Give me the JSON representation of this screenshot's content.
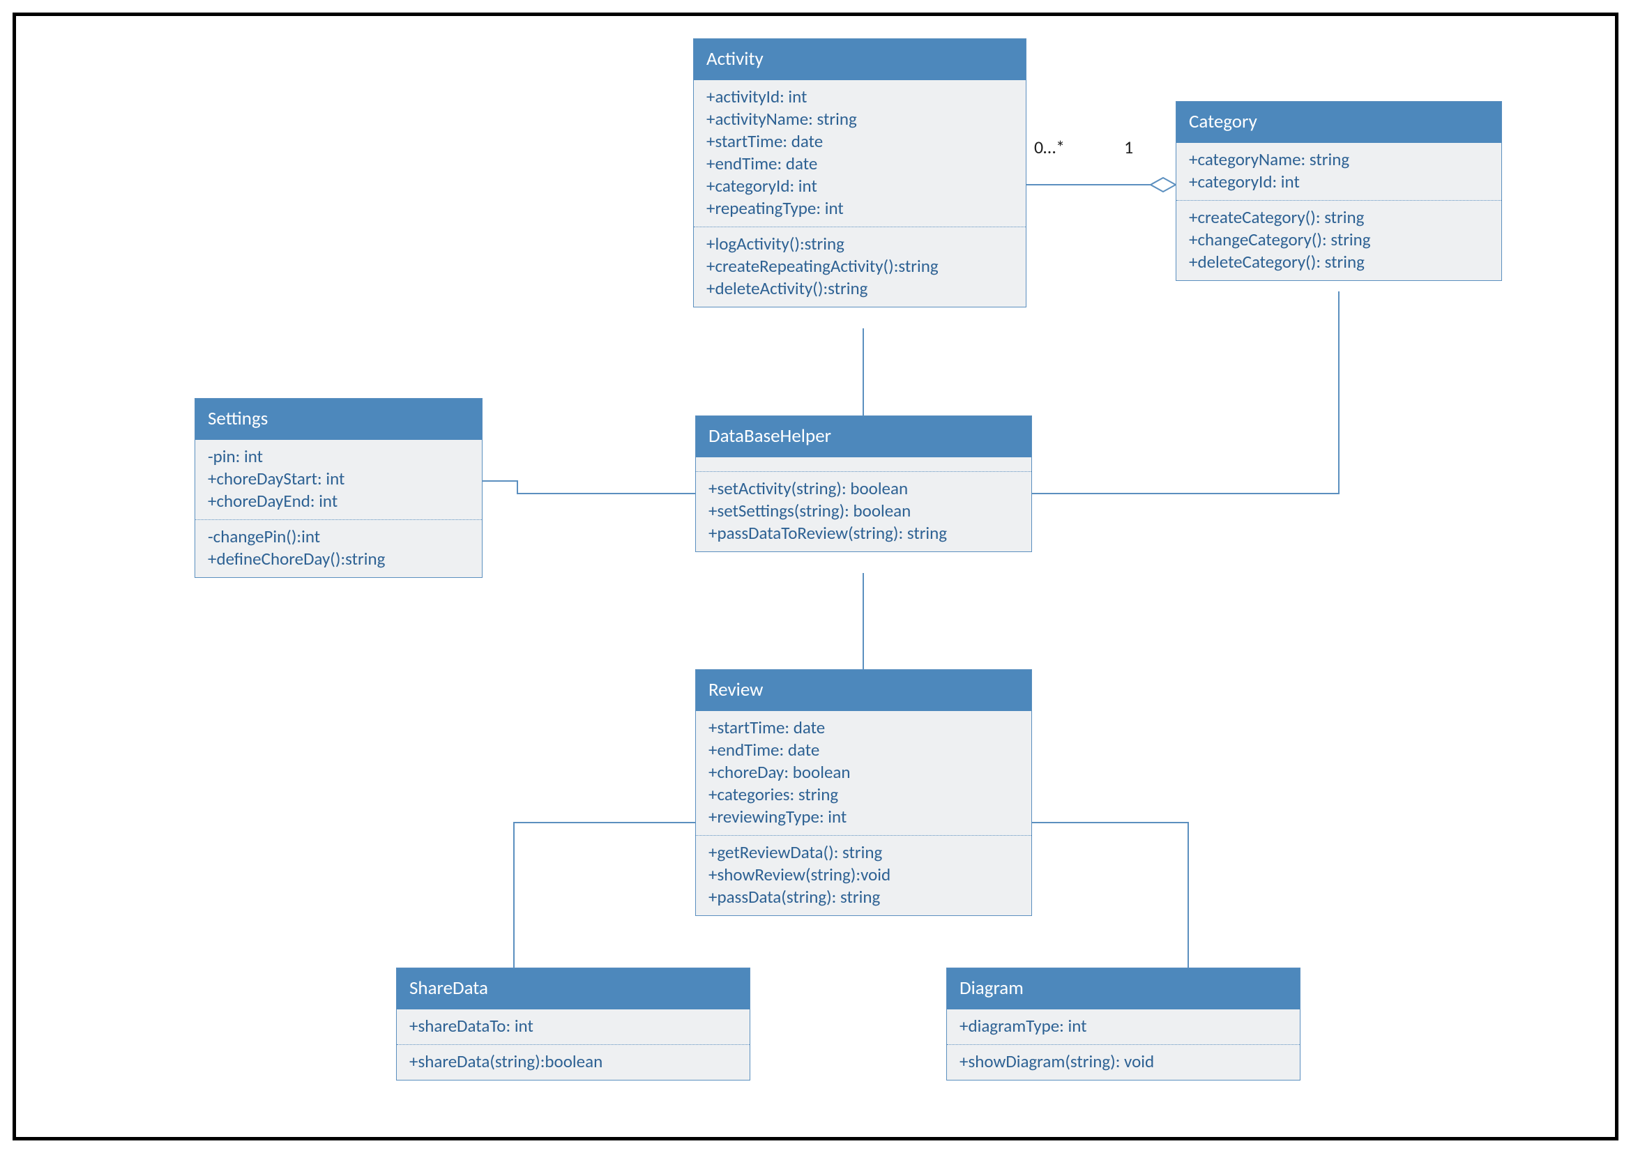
{
  "classes": {
    "activity": {
      "name": "Activity",
      "attrs": [
        "+activityId: int",
        "+activityName: string",
        "+startTime: date",
        "+endTime: date",
        "+categoryId: int",
        "+repeatingType: int"
      ],
      "ops": [
        "+logActivity():string",
        "+createRepeatingActivity():string",
        "+deleteActivity():string"
      ]
    },
    "category": {
      "name": "Category",
      "attrs": [
        "+categoryName: string",
        "+categoryId: int"
      ],
      "ops": [
        "+createCategory(): string",
        "+changeCategory(): string",
        "+deleteCategory(): string"
      ]
    },
    "settings": {
      "name": "Settings",
      "attrs": [
        "-pin: int",
        "+choreDayStart: int",
        "+choreDayEnd: int"
      ],
      "ops": [
        "-changePin():int",
        "+defineChoreDay():string"
      ]
    },
    "dbhelper": {
      "name": "DataBaseHelper",
      "attrs": [],
      "ops": [
        "+setActivity(string): boolean",
        "+setSettings(string): boolean",
        "+passDataToReview(string): string"
      ]
    },
    "review": {
      "name": "Review",
      "attrs": [
        "+startTime: date",
        "+endTime: date",
        "+choreDay: boolean",
        "+categories: string",
        "+reviewingType: int"
      ],
      "ops": [
        "+getReviewData(): string",
        "+showReview(string):void",
        "+passData(string): string"
      ]
    },
    "sharedata": {
      "name": "ShareData",
      "attrs": [
        "+shareDataTo: int"
      ],
      "ops": [
        "+shareData(string):boolean"
      ]
    },
    "diagram": {
      "name": "Diagram",
      "attrs": [
        "+diagramType: int"
      ],
      "ops": [
        "+showDiagram(string): void"
      ]
    }
  },
  "multiplicities": {
    "activitySide": "0…*",
    "categorySide": "1"
  }
}
